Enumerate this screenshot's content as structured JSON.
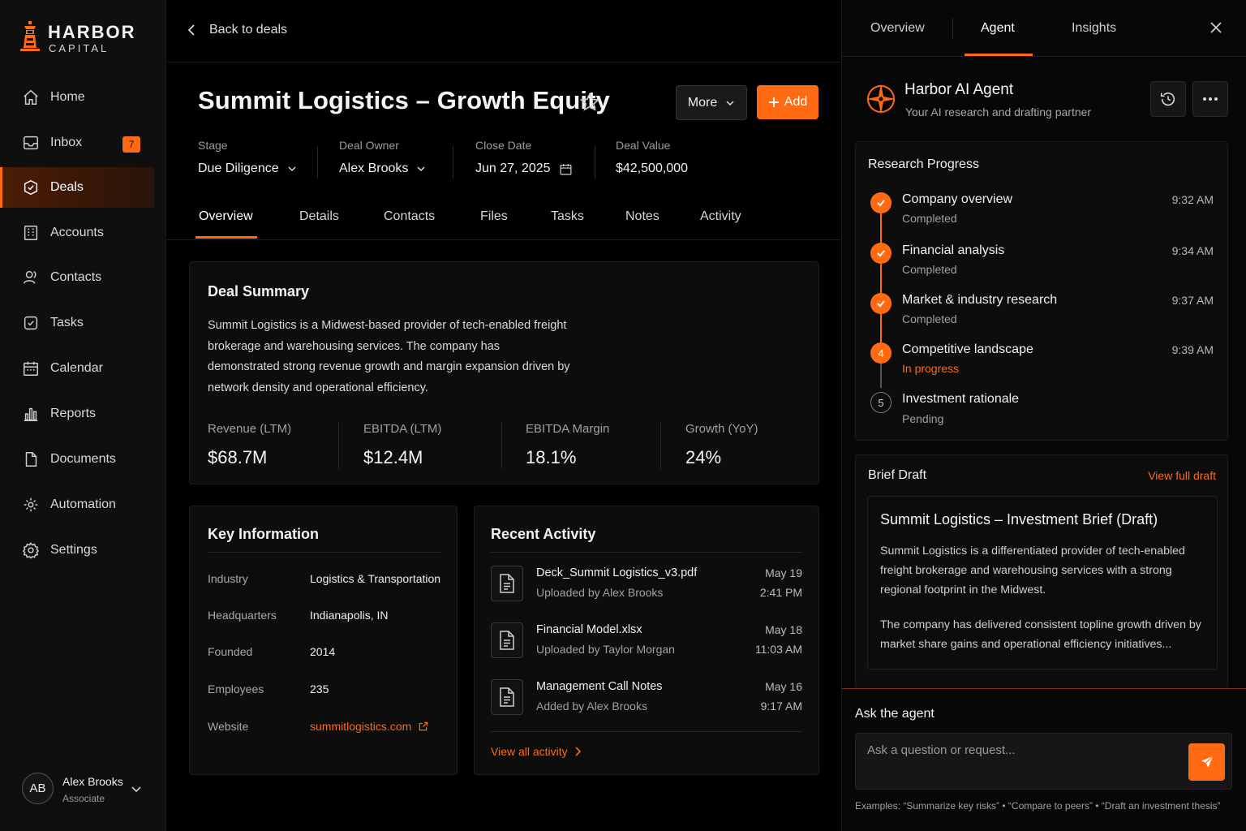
{
  "brand": {
    "line1": "HARBOR",
    "line2": "CAPITAL",
    "accent": "#ff6a13"
  },
  "sidebar": {
    "items": [
      {
        "label": "Home",
        "icon": "home-icon"
      },
      {
        "label": "Inbox",
        "icon": "inbox-icon",
        "badge": "7"
      },
      {
        "label": "Deals",
        "icon": "deals-icon",
        "active": true
      },
      {
        "label": "Accounts",
        "icon": "accounts-icon"
      },
      {
        "label": "Contacts",
        "icon": "contacts-icon"
      },
      {
        "label": "Tasks",
        "icon": "tasks-icon"
      },
      {
        "label": "Calendar",
        "icon": "calendar-icon"
      },
      {
        "label": "Reports",
        "icon": "reports-icon"
      },
      {
        "label": "Documents",
        "icon": "documents-icon"
      },
      {
        "label": "Automation",
        "icon": "automation-icon"
      },
      {
        "label": "Settings",
        "icon": "settings-icon"
      }
    ],
    "user": {
      "initials": "AB",
      "name": "Alex Brooks",
      "role": "Associate"
    }
  },
  "main": {
    "back_label": "Back to deals",
    "title": "Summit Logistics – Growth Equity",
    "more_label": "More",
    "add_label": "Add",
    "meta": {
      "stage": {
        "label": "Stage",
        "value": "Due Diligence"
      },
      "owner": {
        "label": "Deal Owner",
        "value": "Alex Brooks"
      },
      "close": {
        "label": "Close Date",
        "value": "Jun 27, 2025"
      },
      "value": {
        "label": "Deal Value",
        "value": "$42,500,000"
      }
    },
    "tabs": [
      "Overview",
      "Details",
      "Contacts",
      "Files",
      "Tasks",
      "Notes",
      "Activity"
    ],
    "summary": {
      "title": "Deal Summary",
      "text": "Summit Logistics is a Midwest-based provider of tech-enabled freight brokerage and warehousing services. The company has demonstrated strong revenue growth and margin expansion driven by network density and operational efficiency.",
      "metrics": [
        {
          "label": "Revenue (LTM)",
          "value": "$68.7M"
        },
        {
          "label": "EBITDA (LTM)",
          "value": "$12.4M"
        },
        {
          "label": "EBITDA Margin",
          "value": "18.1%"
        },
        {
          "label": "Growth (YoY)",
          "value": "24%"
        }
      ]
    },
    "key_info": {
      "title": "Key Information",
      "rows": [
        {
          "label": "Industry",
          "value": "Logistics & Transportation"
        },
        {
          "label": "Headquarters",
          "value": "Indianapolis, IN"
        },
        {
          "label": "Founded",
          "value": "2014"
        },
        {
          "label": "Employees",
          "value": "235"
        },
        {
          "label": "Website",
          "value": "summitlogistics.com"
        }
      ]
    },
    "activity": {
      "title": "Recent Activity",
      "items": [
        {
          "name": "Deck_Summit Logistics_v3.pdf",
          "sub": "Uploaded by Alex Brooks",
          "date": "May 19",
          "time": "2:41 PM"
        },
        {
          "name": "Financial Model.xlsx",
          "sub": "Uploaded by Taylor Morgan",
          "date": "May 18",
          "time": "11:03 AM"
        },
        {
          "name": "Management Call Notes",
          "sub": "Added by Alex Brooks",
          "date": "May 16",
          "time": "9:17 AM"
        }
      ],
      "view_all": "View all activity"
    }
  },
  "panel": {
    "tabs": [
      "Overview",
      "Agent",
      "Insights"
    ],
    "agent": {
      "name": "Harbor AI Agent",
      "subtitle": "Your AI research and drafting partner"
    },
    "progress": {
      "title": "Research Progress",
      "steps": [
        {
          "num": "1",
          "title": "Company overview",
          "status": "Completed",
          "time": "9:32 AM",
          "state": "done"
        },
        {
          "num": "2",
          "title": "Financial analysis",
          "status": "Completed",
          "time": "9:34 AM",
          "state": "done"
        },
        {
          "num": "3",
          "title": "Market & industry research",
          "status": "Completed",
          "time": "9:37 AM",
          "state": "done"
        },
        {
          "num": "4",
          "title": "Competitive landscape",
          "status": "In progress",
          "time": "9:39 AM",
          "state": "active"
        },
        {
          "num": "5",
          "title": "Investment rationale",
          "status": "Pending",
          "time": "",
          "state": "pending"
        }
      ]
    },
    "brief": {
      "title": "Brief Draft",
      "view_full": "View full draft",
      "doc_title": "Summit Logistics – Investment Brief (Draft)",
      "p1": "Summit Logistics is a differentiated provider of tech-enabled freight brokerage and warehousing services with a strong regional footprint in the Midwest.",
      "p2": "The company has delivered consistent topline growth driven by market share gains and operational efficiency initiatives..."
    },
    "ask": {
      "title": "Ask the agent",
      "placeholder": "Ask a question or request...",
      "examples": "Examples: “Summarize key risks”  •  “Compare to peers”  •  “Draft an investment thesis”"
    }
  }
}
